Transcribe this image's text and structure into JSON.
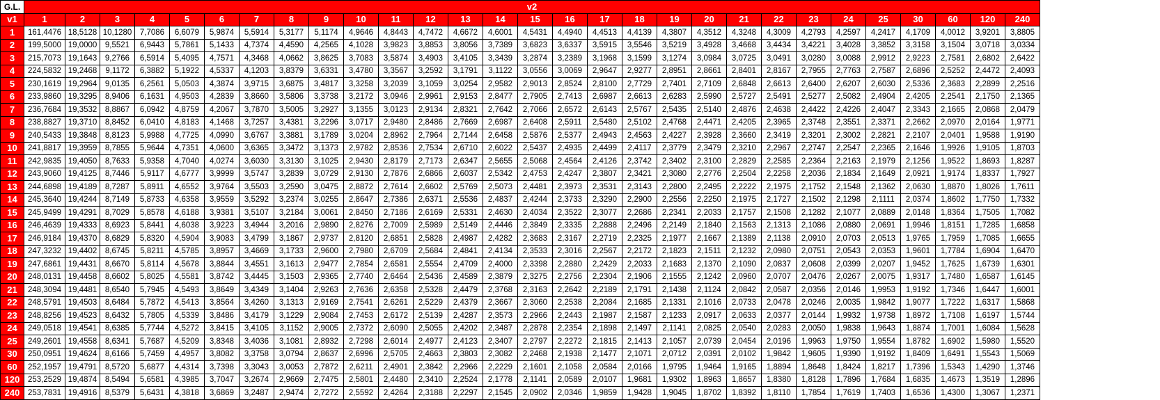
{
  "table": {
    "corner_label": "G.L.",
    "row_axis_label": "v1",
    "col_axis_label": "v2",
    "columns": [
      "1",
      "2",
      "3",
      "4",
      "5",
      "6",
      "7",
      "8",
      "9",
      "10",
      "11",
      "12",
      "13",
      "14",
      "15",
      "16",
      "17",
      "18",
      "19",
      "20",
      "21",
      "22",
      "23",
      "24",
      "25",
      "30",
      "60",
      "120",
      "240"
    ],
    "rows": [
      {
        "label": "1",
        "values": [
          "161,4476",
          "18,5128",
          "10,1280",
          "7,7086",
          "6,6079",
          "5,9874",
          "5,5914",
          "5,3177",
          "5,1174",
          "4,9646",
          "4,8443",
          "4,7472",
          "4,6672",
          "4,6001",
          "4,5431",
          "4,4940",
          "4,4513",
          "4,4139",
          "4,3807",
          "4,3512",
          "4,3248",
          "4,3009",
          "4,2793",
          "4,2597",
          "4,2417",
          "4,1709",
          "4,0012",
          "3,9201",
          "3,8805"
        ]
      },
      {
        "label": "2",
        "values": [
          "199,5000",
          "19,0000",
          "9,5521",
          "6,9443",
          "5,7861",
          "5,1433",
          "4,7374",
          "4,4590",
          "4,2565",
          "4,1028",
          "3,9823",
          "3,8853",
          "3,8056",
          "3,7389",
          "3,6823",
          "3,6337",
          "3,5915",
          "3,5546",
          "3,5219",
          "3,4928",
          "3,4668",
          "3,4434",
          "3,4221",
          "3,4028",
          "3,3852",
          "3,3158",
          "3,1504",
          "3,0718",
          "3,0334"
        ]
      },
      {
        "label": "3",
        "values": [
          "215,7073",
          "19,1643",
          "9,2766",
          "6,5914",
          "5,4095",
          "4,7571",
          "4,3468",
          "4,0662",
          "3,8625",
          "3,7083",
          "3,5874",
          "3,4903",
          "3,4105",
          "3,3439",
          "3,2874",
          "3,2389",
          "3,1968",
          "3,1599",
          "3,1274",
          "3,0984",
          "3,0725",
          "3,0491",
          "3,0280",
          "3,0088",
          "2,9912",
          "2,9223",
          "2,7581",
          "2,6802",
          "2,6422"
        ]
      },
      {
        "label": "4",
        "values": [
          "224,5832",
          "19,2468",
          "9,1172",
          "6,3882",
          "5,1922",
          "4,5337",
          "4,1203",
          "3,8379",
          "3,6331",
          "3,4780",
          "3,3567",
          "3,2592",
          "3,1791",
          "3,1122",
          "3,0556",
          "3,0069",
          "2,9647",
          "2,9277",
          "2,8951",
          "2,8661",
          "2,8401",
          "2,8167",
          "2,7955",
          "2,7763",
          "2,7587",
          "2,6896",
          "2,5252",
          "2,4472",
          "2,4093"
        ]
      },
      {
        "label": "5",
        "values": [
          "230,1619",
          "19,2964",
          "9,0135",
          "6,2561",
          "5,0503",
          "4,3874",
          "3,9715",
          "3,6875",
          "3,4817",
          "3,3258",
          "3,2039",
          "3,1059",
          "3,0254",
          "2,9582",
          "2,9013",
          "2,8524",
          "2,8100",
          "2,7729",
          "2,7401",
          "2,7109",
          "2,6848",
          "2,6613",
          "2,6400",
          "2,6207",
          "2,6030",
          "2,5336",
          "2,3683",
          "2,2899",
          "2,2516"
        ]
      },
      {
        "label": "6",
        "values": [
          "233,9860",
          "19,3295",
          "8,9406",
          "6,1631",
          "4,9503",
          "4,2839",
          "3,8660",
          "3,5806",
          "3,3738",
          "3,2172",
          "3,0946",
          "2,9961",
          "2,9153",
          "2,8477",
          "2,7905",
          "2,7413",
          "2,6987",
          "2,6613",
          "2,6283",
          "2,5990",
          "2,5727",
          "2,5491",
          "2,5277",
          "2,5082",
          "2,4904",
          "2,4205",
          "2,2541",
          "2,1750",
          "2,1365"
        ]
      },
      {
        "label": "7",
        "values": [
          "236,7684",
          "19,3532",
          "8,8867",
          "6,0942",
          "4,8759",
          "4,2067",
          "3,7870",
          "3,5005",
          "3,2927",
          "3,1355",
          "3,0123",
          "2,9134",
          "2,8321",
          "2,7642",
          "2,7066",
          "2,6572",
          "2,6143",
          "2,5767",
          "2,5435",
          "2,5140",
          "2,4876",
          "2,4638",
          "2,4422",
          "2,4226",
          "2,4047",
          "2,3343",
          "2,1665",
          "2,0868",
          "2,0479"
        ]
      },
      {
        "label": "8",
        "values": [
          "238,8827",
          "19,3710",
          "8,8452",
          "6,0410",
          "4,8183",
          "4,1468",
          "3,7257",
          "3,4381",
          "3,2296",
          "3,0717",
          "2,9480",
          "2,8486",
          "2,7669",
          "2,6987",
          "2,6408",
          "2,5911",
          "2,5480",
          "2,5102",
          "2,4768",
          "2,4471",
          "2,4205",
          "2,3965",
          "2,3748",
          "2,3551",
          "2,3371",
          "2,2662",
          "2,0970",
          "2,0164",
          "1,9771"
        ]
      },
      {
        "label": "9",
        "values": [
          "240,5433",
          "19,3848",
          "8,8123",
          "5,9988",
          "4,7725",
          "4,0990",
          "3,6767",
          "3,3881",
          "3,1789",
          "3,0204",
          "2,8962",
          "2,7964",
          "2,7144",
          "2,6458",
          "2,5876",
          "2,5377",
          "2,4943",
          "2,4563",
          "2,4227",
          "2,3928",
          "2,3660",
          "2,3419",
          "2,3201",
          "2,3002",
          "2,2821",
          "2,2107",
          "2,0401",
          "1,9588",
          "1,9190"
        ]
      },
      {
        "label": "10",
        "values": [
          "241,8817",
          "19,3959",
          "8,7855",
          "5,9644",
          "4,7351",
          "4,0600",
          "3,6365",
          "3,3472",
          "3,1373",
          "2,9782",
          "2,8536",
          "2,7534",
          "2,6710",
          "2,6022",
          "2,5437",
          "2,4935",
          "2,4499",
          "2,4117",
          "2,3779",
          "2,3479",
          "2,3210",
          "2,2967",
          "2,2747",
          "2,2547",
          "2,2365",
          "2,1646",
          "1,9926",
          "1,9105",
          "1,8703"
        ]
      },
      {
        "label": "11",
        "values": [
          "242,9835",
          "19,4050",
          "8,7633",
          "5,9358",
          "4,7040",
          "4,0274",
          "3,6030",
          "3,3130",
          "3,1025",
          "2,9430",
          "2,8179",
          "2,7173",
          "2,6347",
          "2,5655",
          "2,5068",
          "2,4564",
          "2,4126",
          "2,3742",
          "2,3402",
          "2,3100",
          "2,2829",
          "2,2585",
          "2,2364",
          "2,2163",
          "2,1979",
          "2,1256",
          "1,9522",
          "1,8693",
          "1,8287"
        ]
      },
      {
        "label": "12",
        "values": [
          "243,9060",
          "19,4125",
          "8,7446",
          "5,9117",
          "4,6777",
          "3,9999",
          "3,5747",
          "3,2839",
          "3,0729",
          "2,9130",
          "2,7876",
          "2,6866",
          "2,6037",
          "2,5342",
          "2,4753",
          "2,4247",
          "2,3807",
          "2,3421",
          "2,3080",
          "2,2776",
          "2,2504",
          "2,2258",
          "2,2036",
          "2,1834",
          "2,1649",
          "2,0921",
          "1,9174",
          "1,8337",
          "1,7927"
        ]
      },
      {
        "label": "13",
        "values": [
          "244,6898",
          "19,4189",
          "8,7287",
          "5,8911",
          "4,6552",
          "3,9764",
          "3,5503",
          "3,2590",
          "3,0475",
          "2,8872",
          "2,7614",
          "2,6602",
          "2,5769",
          "2,5073",
          "2,4481",
          "2,3973",
          "2,3531",
          "2,3143",
          "2,2800",
          "2,2495",
          "2,2222",
          "2,1975",
          "2,1752",
          "2,1548",
          "2,1362",
          "2,0630",
          "1,8870",
          "1,8026",
          "1,7611"
        ]
      },
      {
        "label": "14",
        "values": [
          "245,3640",
          "19,4244",
          "8,7149",
          "5,8733",
          "4,6358",
          "3,9559",
          "3,5292",
          "3,2374",
          "3,0255",
          "2,8647",
          "2,7386",
          "2,6371",
          "2,5536",
          "2,4837",
          "2,4244",
          "2,3733",
          "2,3290",
          "2,2900",
          "2,2556",
          "2,2250",
          "2,1975",
          "2,1727",
          "2,1502",
          "2,1298",
          "2,1111",
          "2,0374",
          "1,8602",
          "1,7750",
          "1,7332"
        ]
      },
      {
        "label": "15",
        "values": [
          "245,9499",
          "19,4291",
          "8,7029",
          "5,8578",
          "4,6188",
          "3,9381",
          "3,5107",
          "3,2184",
          "3,0061",
          "2,8450",
          "2,7186",
          "2,6169",
          "2,5331",
          "2,4630",
          "2,4034",
          "2,3522",
          "2,3077",
          "2,2686",
          "2,2341",
          "2,2033",
          "2,1757",
          "2,1508",
          "2,1282",
          "2,1077",
          "2,0889",
          "2,0148",
          "1,8364",
          "1,7505",
          "1,7082"
        ]
      },
      {
        "label": "16",
        "values": [
          "246,4639",
          "19,4333",
          "8,6923",
          "5,8441",
          "4,6038",
          "3,9223",
          "3,4944",
          "3,2016",
          "2,9890",
          "2,8276",
          "2,7009",
          "2,5989",
          "2,5149",
          "2,4446",
          "2,3849",
          "2,3335",
          "2,2888",
          "2,2496",
          "2,2149",
          "2,1840",
          "2,1563",
          "2,1313",
          "2,1086",
          "2,0880",
          "2,0691",
          "1,9946",
          "1,8151",
          "1,7285",
          "1,6858"
        ]
      },
      {
        "label": "17",
        "values": [
          "246,9184",
          "19,4370",
          "8,6829",
          "5,8320",
          "4,5904",
          "3,9083",
          "3,4799",
          "3,1867",
          "2,9737",
          "2,8120",
          "2,6851",
          "2,5828",
          "2,4987",
          "2,4282",
          "2,3683",
          "2,3167",
          "2,2719",
          "2,2325",
          "2,1977",
          "2,1667",
          "2,1389",
          "2,1138",
          "2,0910",
          "2,0703",
          "2,0513",
          "1,9765",
          "1,7959",
          "1,7085",
          "1,6655"
        ]
      },
      {
        "label": "18",
        "values": [
          "247,3232",
          "19,4402",
          "8,6745",
          "5,8211",
          "4,5785",
          "3,8957",
          "3,4669",
          "3,1733",
          "2,9600",
          "2,7980",
          "2,6709",
          "2,5684",
          "2,4841",
          "2,4134",
          "2,3533",
          "2,3016",
          "2,2567",
          "2,2172",
          "2,1823",
          "2,1511",
          "2,1232",
          "2,0980",
          "2,0751",
          "2,0543",
          "2,0353",
          "1,9601",
          "1,7784",
          "1,6904",
          "1,6470"
        ]
      },
      {
        "label": "19",
        "values": [
          "247,6861",
          "19,4431",
          "8,6670",
          "5,8114",
          "4,5678",
          "3,8844",
          "3,4551",
          "3,1613",
          "2,9477",
          "2,7854",
          "2,6581",
          "2,5554",
          "2,4709",
          "2,4000",
          "2,3398",
          "2,2880",
          "2,2429",
          "2,2033",
          "2,1683",
          "2,1370",
          "2,1090",
          "2,0837",
          "2,0608",
          "2,0399",
          "2,0207",
          "1,9452",
          "1,7625",
          "1,6739",
          "1,6301"
        ]
      },
      {
        "label": "20",
        "values": [
          "248,0131",
          "19,4458",
          "8,6602",
          "5,8025",
          "4,5581",
          "3,8742",
          "3,4445",
          "3,1503",
          "2,9365",
          "2,7740",
          "2,6464",
          "2,5436",
          "2,4589",
          "2,3879",
          "2,3275",
          "2,2756",
          "2,2304",
          "2,1906",
          "2,1555",
          "2,1242",
          "2,0960",
          "2,0707",
          "2,0476",
          "2,0267",
          "2,0075",
          "1,9317",
          "1,7480",
          "1,6587",
          "1,6145"
        ]
      },
      {
        "label": "21",
        "values": [
          "248,3094",
          "19,4481",
          "8,6540",
          "5,7945",
          "4,5493",
          "3,8649",
          "3,4349",
          "3,1404",
          "2,9263",
          "2,7636",
          "2,6358",
          "2,5328",
          "2,4479",
          "2,3768",
          "2,3163",
          "2,2642",
          "2,2189",
          "2,1791",
          "2,1438",
          "2,1124",
          "2,0842",
          "2,0587",
          "2,0356",
          "2,0146",
          "1,9953",
          "1,9192",
          "1,7346",
          "1,6447",
          "1,6001"
        ]
      },
      {
        "label": "22",
        "values": [
          "248,5791",
          "19,4503",
          "8,6484",
          "5,7872",
          "4,5413",
          "3,8564",
          "3,4260",
          "3,1313",
          "2,9169",
          "2,7541",
          "2,6261",
          "2,5229",
          "2,4379",
          "2,3667",
          "2,3060",
          "2,2538",
          "2,2084",
          "2,1685",
          "2,1331",
          "2,1016",
          "2,0733",
          "2,0478",
          "2,0246",
          "2,0035",
          "1,9842",
          "1,9077",
          "1,7222",
          "1,6317",
          "1,5868"
        ]
      },
      {
        "label": "23",
        "values": [
          "248,8256",
          "19,4523",
          "8,6432",
          "5,7805",
          "4,5339",
          "3,8486",
          "3,4179",
          "3,1229",
          "2,9084",
          "2,7453",
          "2,6172",
          "2,5139",
          "2,4287",
          "2,3573",
          "2,2966",
          "2,2443",
          "2,1987",
          "2,1587",
          "2,1233",
          "2,0917",
          "2,0633",
          "2,0377",
          "2,0144",
          "1,9932",
          "1,9738",
          "1,8972",
          "1,7108",
          "1,6197",
          "1,5744"
        ]
      },
      {
        "label": "24",
        "values": [
          "249,0518",
          "19,4541",
          "8,6385",
          "5,7744",
          "4,5272",
          "3,8415",
          "3,4105",
          "3,1152",
          "2,9005",
          "2,7372",
          "2,6090",
          "2,5055",
          "2,4202",
          "2,3487",
          "2,2878",
          "2,2354",
          "2,1898",
          "2,1497",
          "2,1141",
          "2,0825",
          "2,0540",
          "2,0283",
          "2,0050",
          "1,9838",
          "1,9643",
          "1,8874",
          "1,7001",
          "1,6084",
          "1,5628"
        ]
      },
      {
        "label": "25",
        "values": [
          "249,2601",
          "19,4558",
          "8,6341",
          "5,7687",
          "4,5209",
          "3,8348",
          "3,4036",
          "3,1081",
          "2,8932",
          "2,7298",
          "2,6014",
          "2,4977",
          "2,4123",
          "2,3407",
          "2,2797",
          "2,2272",
          "2,1815",
          "2,1413",
          "2,1057",
          "2,0739",
          "2,0454",
          "2,0196",
          "1,9963",
          "1,9750",
          "1,9554",
          "1,8782",
          "1,6902",
          "1,5980",
          "1,5520"
        ]
      },
      {
        "label": "30",
        "values": [
          "250,0951",
          "19,4624",
          "8,6166",
          "5,7459",
          "4,4957",
          "3,8082",
          "3,3758",
          "3,0794",
          "2,8637",
          "2,6996",
          "2,5705",
          "2,4663",
          "2,3803",
          "2,3082",
          "2,2468",
          "2,1938",
          "2,1477",
          "2,1071",
          "2,0712",
          "2,0391",
          "2,0102",
          "1,9842",
          "1,9605",
          "1,9390",
          "1,9192",
          "1,8409",
          "1,6491",
          "1,5543",
          "1,5069"
        ]
      },
      {
        "label": "60",
        "values": [
          "252,1957",
          "19,4791",
          "8,5720",
          "5,6877",
          "4,4314",
          "3,7398",
          "3,3043",
          "3,0053",
          "2,7872",
          "2,6211",
          "2,4901",
          "2,3842",
          "2,2966",
          "2,2229",
          "2,1601",
          "2,1058",
          "2,0584",
          "2,0166",
          "1,9795",
          "1,9464",
          "1,9165",
          "1,8894",
          "1,8648",
          "1,8424",
          "1,8217",
          "1,7396",
          "1,5343",
          "1,4290",
          "1,3746"
        ]
      },
      {
        "label": "120",
        "values": [
          "253,2529",
          "19,4874",
          "8,5494",
          "5,6581",
          "4,3985",
          "3,7047",
          "3,2674",
          "2,9669",
          "2,7475",
          "2,5801",
          "2,4480",
          "2,3410",
          "2,2524",
          "2,1778",
          "2,1141",
          "2,0589",
          "2,0107",
          "1,9681",
          "1,9302",
          "1,8963",
          "1,8657",
          "1,8380",
          "1,8128",
          "1,7896",
          "1,7684",
          "1,6835",
          "1,4673",
          "1,3519",
          "1,2896"
        ]
      },
      {
        "label": "240",
        "values": [
          "253,7831",
          "19,4916",
          "8,5379",
          "5,6431",
          "4,3818",
          "3,6869",
          "3,2487",
          "2,9474",
          "2,7272",
          "2,5592",
          "2,4264",
          "2,3188",
          "2,2297",
          "2,1545",
          "2,0902",
          "2,0346",
          "1,9859",
          "1,9428",
          "1,9045",
          "1,8702",
          "1,8392",
          "1,8110",
          "1,7854",
          "1,7619",
          "1,7403",
          "1,6536",
          "1,4300",
          "1,3067",
          "1,2371"
        ]
      }
    ]
  },
  "colors": {
    "header_bg": "#ff0000",
    "header_text": "#ffffff",
    "cell_bg": "#ffffff",
    "border": "#000000"
  }
}
